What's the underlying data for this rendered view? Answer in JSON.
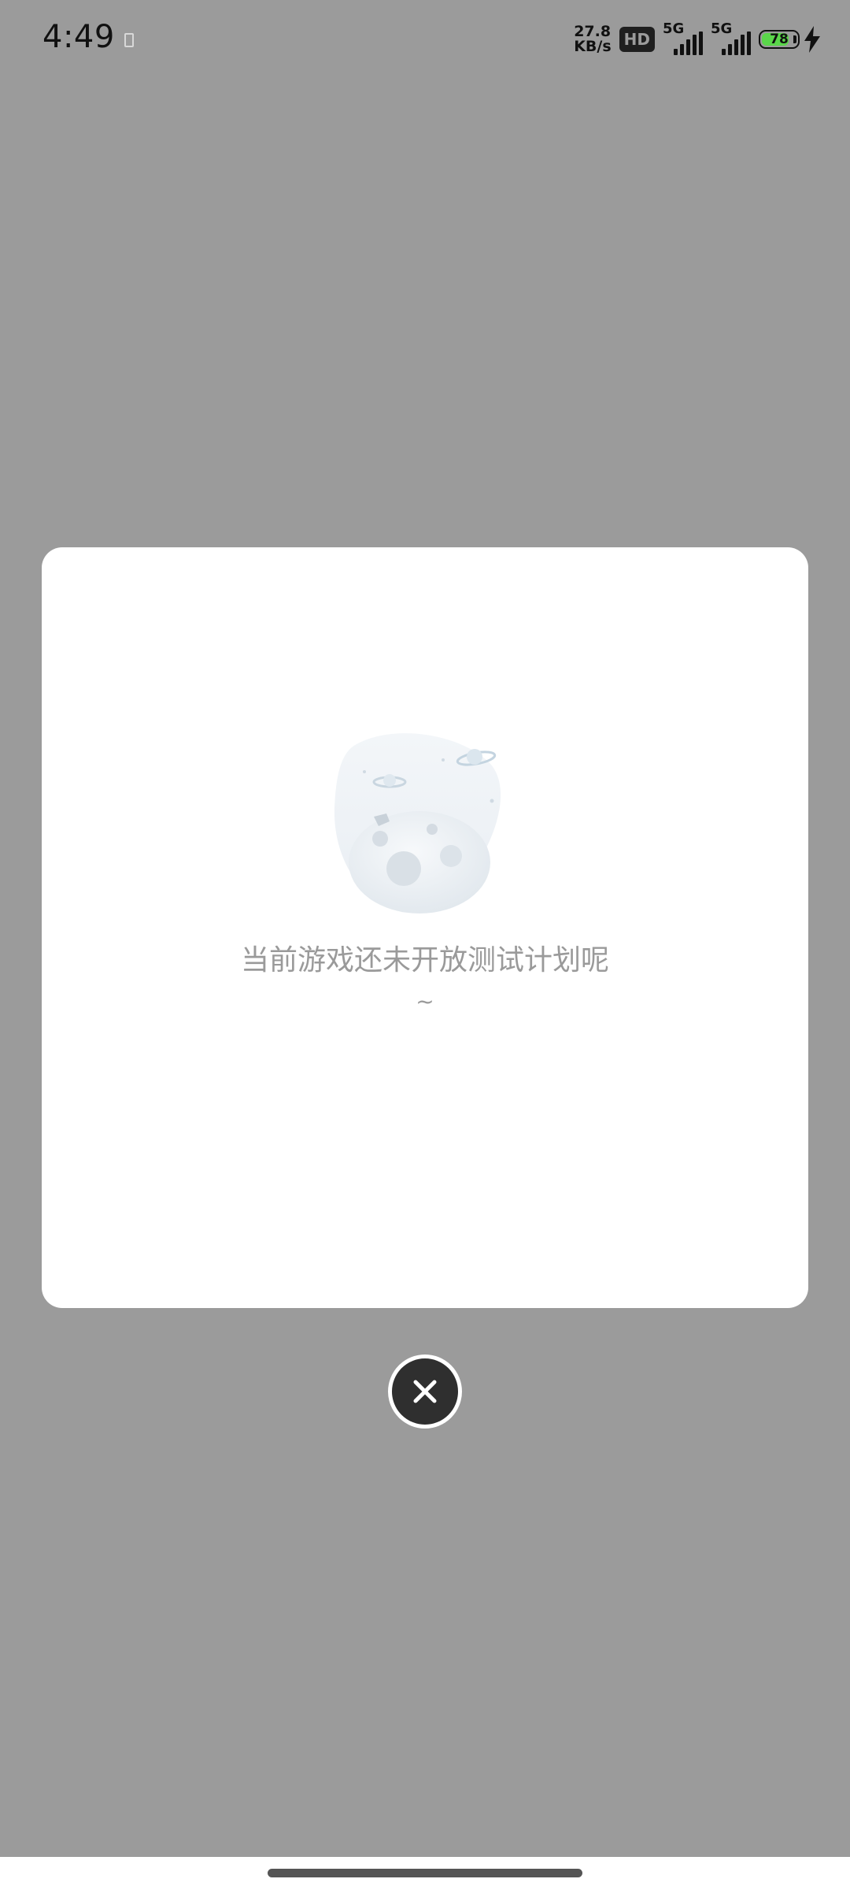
{
  "status_bar": {
    "time": "4:49",
    "net_speed_value": "27.8",
    "net_speed_unit": "KB/s",
    "hd_badge": "HD",
    "signal_1_label": "5G",
    "signal_2_label": "5G",
    "battery_level": "78",
    "battery_color": "#5ad64a"
  },
  "dialog": {
    "message": "当前游戏还未开放测试计划呢",
    "message_tail": "~",
    "illustration_icon": "empty-planet-illustration"
  },
  "close_button": {
    "icon": "close-icon"
  },
  "colors": {
    "overlay": "#9b9b9b",
    "dialog_bg": "#ffffff",
    "message_text": "#9a9a9a",
    "close_bg": "#2f2f2f"
  }
}
